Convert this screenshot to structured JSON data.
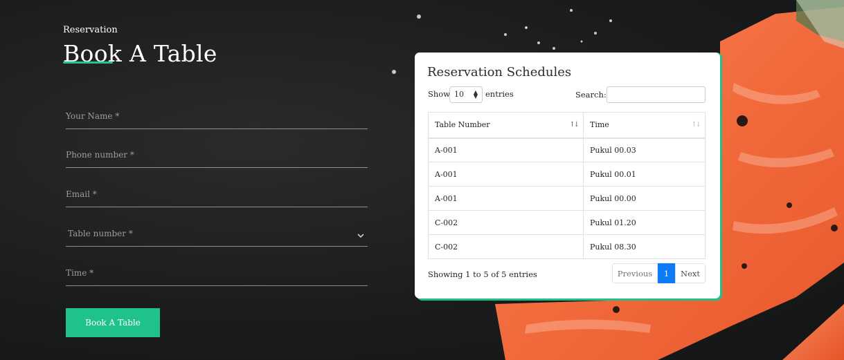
{
  "form": {
    "subtitle": "Reservation",
    "heading": "Book A Table",
    "fields": {
      "name_placeholder": "Your Name *",
      "phone_placeholder": "Phone number *",
      "email_placeholder": "Email *",
      "table_placeholder": "Table number *",
      "time_placeholder": "Time *"
    },
    "submit_label": "Book A Table"
  },
  "schedule": {
    "title": "Reservation Schedules",
    "show_label": "Show",
    "entries_value": "10",
    "entries_label": "entries",
    "search_label": "Search:",
    "search_value": "",
    "columns": [
      "Table Number",
      "Time"
    ],
    "rows": [
      [
        "A-001",
        "Pukul 00.03"
      ],
      [
        "A-001",
        "Pukul 00.01"
      ],
      [
        "A-001",
        "Pukul 00.00"
      ],
      [
        "C-002",
        "Pukul 01.20"
      ],
      [
        "C-002",
        "Pukul 08.30"
      ]
    ],
    "info": "Showing 1 to 5 of 5 entries",
    "pagination": {
      "previous": "Previous",
      "current": "1",
      "next": "Next"
    }
  },
  "colors": {
    "accent": "#1fc38a",
    "page_active": "#0d7bf7"
  }
}
